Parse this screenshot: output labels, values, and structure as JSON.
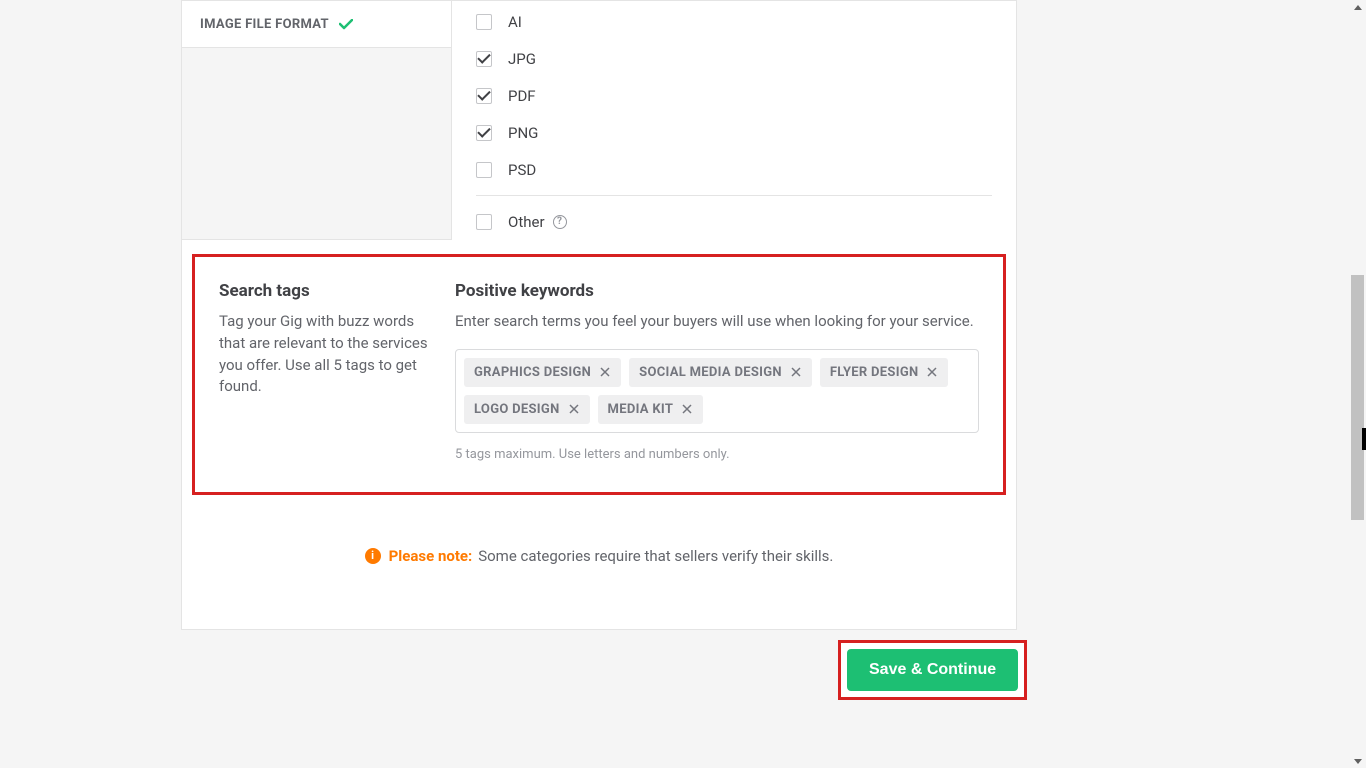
{
  "format_section": {
    "title": "IMAGE FILE FORMAT",
    "options": [
      {
        "label": "AI",
        "checked": false
      },
      {
        "label": "JPG",
        "checked": true
      },
      {
        "label": "PDF",
        "checked": true
      },
      {
        "label": "PNG",
        "checked": true
      },
      {
        "label": "PSD",
        "checked": false
      }
    ],
    "other": {
      "label": "Other",
      "checked": false
    }
  },
  "search_tags": {
    "title": "Search tags",
    "description": "Tag your Gig with buzz words that are relevant to the services you offer. Use all 5 tags to get found."
  },
  "keywords": {
    "title": "Positive keywords",
    "description": "Enter search terms you feel your buyers will use when looking for your service.",
    "tags": [
      "GRAPHICS DESIGN",
      "SOCIAL MEDIA DESIGN",
      "FLYER DESIGN",
      "LOGO DESIGN",
      "MEDIA KIT"
    ],
    "hint": "5 tags maximum. Use letters and numbers only."
  },
  "note": {
    "label": "Please note:",
    "text": "Some categories require that sellers verify their skills."
  },
  "actions": {
    "save_continue": "Save & Continue"
  }
}
